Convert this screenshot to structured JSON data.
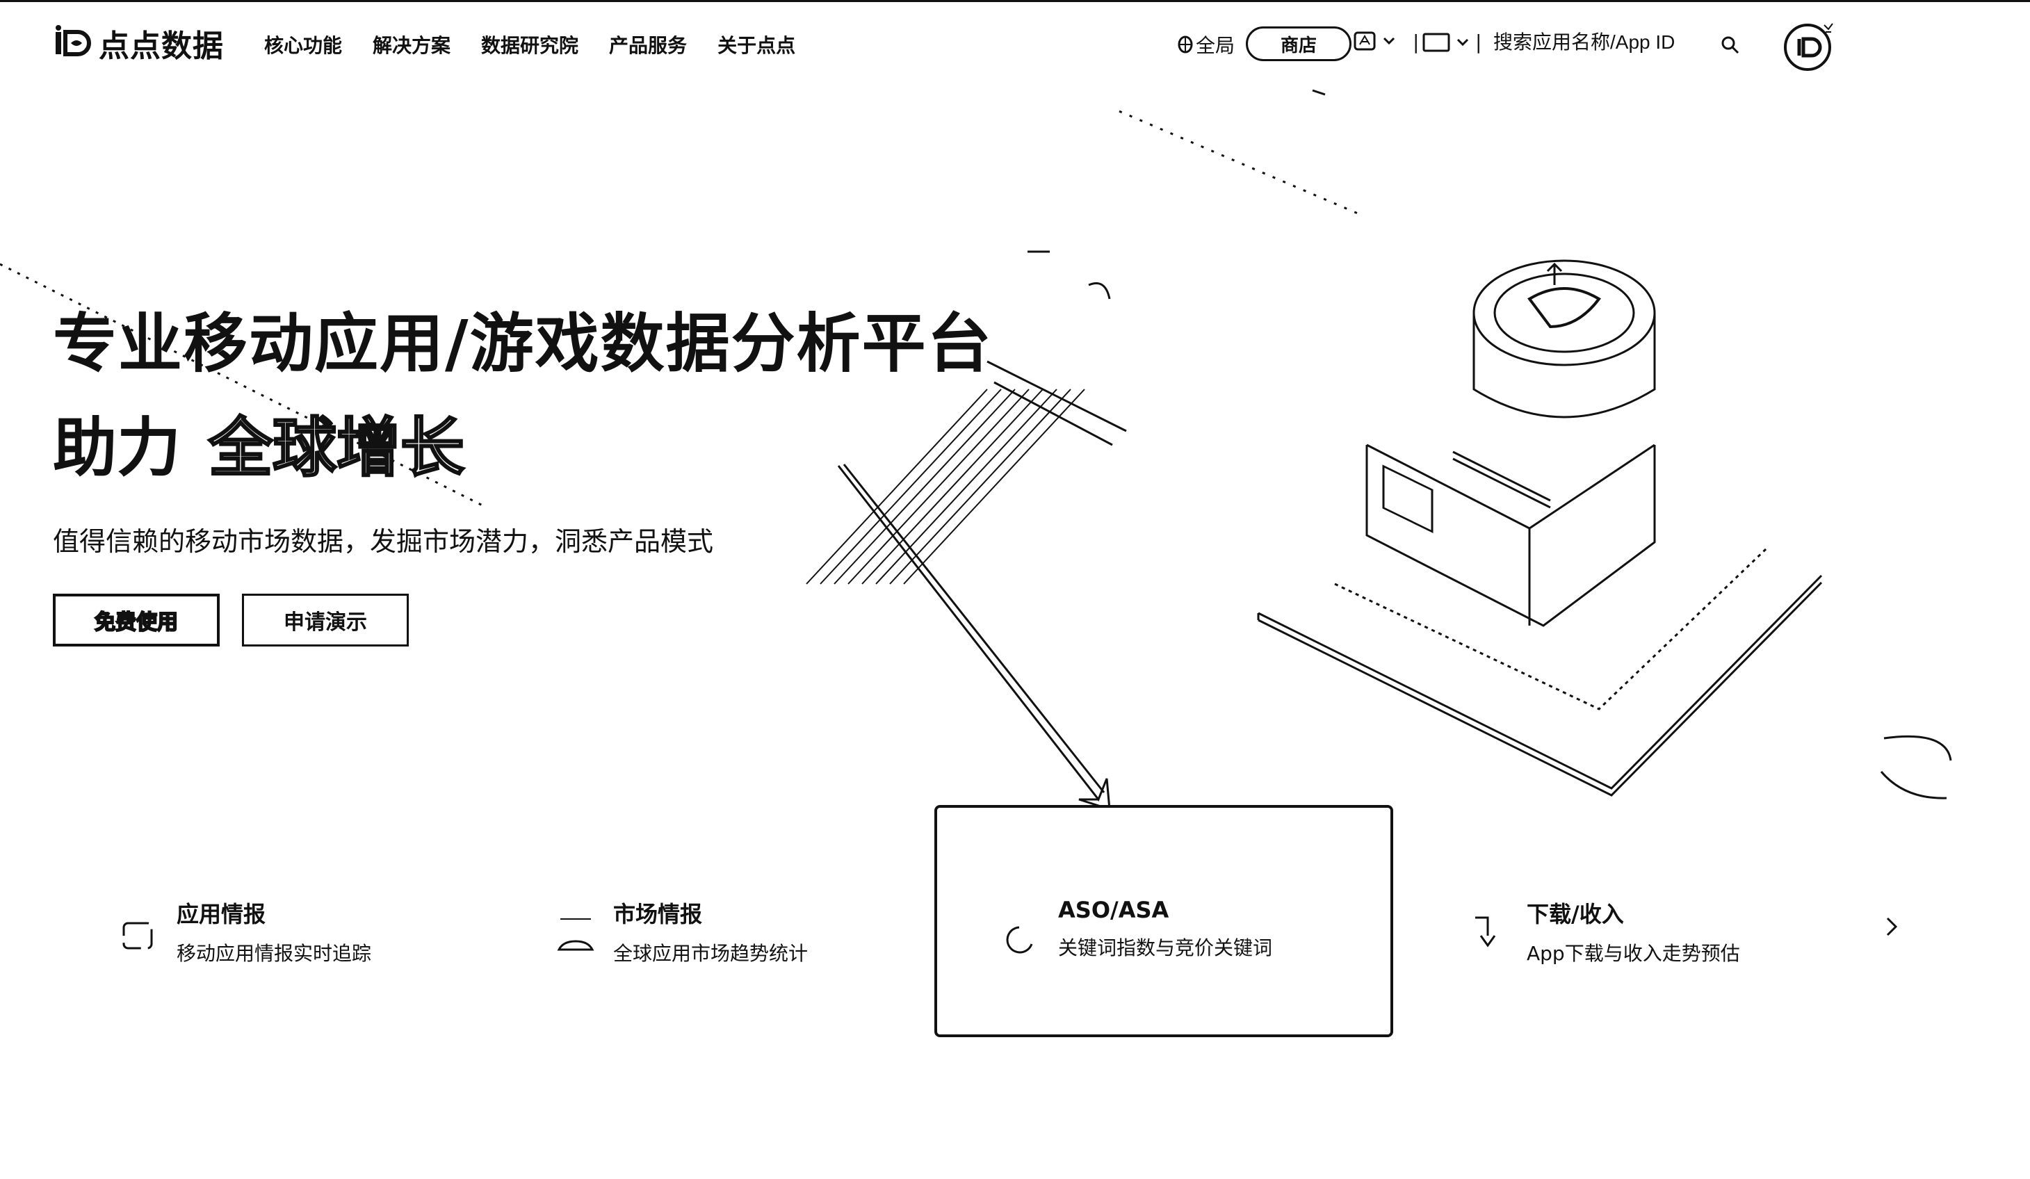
{
  "header": {
    "logo_text": "点点数据",
    "nav": [
      "核心功能",
      "解决方案",
      "数据研究院",
      "产品服务",
      "关于点点"
    ],
    "region_label": "全局",
    "store_label": "商店",
    "separator": "|",
    "search_placeholder": "搜索应用名称/App ID"
  },
  "hero": {
    "title": "专业移动应用/游戏数据分析平台",
    "sub_plain": "助力",
    "sub_outline": "全球增长",
    "description": "值得信赖的移动市场数据，发掘市场潜力，洞悉产品模式",
    "btn_free": "免费使用",
    "btn_demo": "申请演示"
  },
  "features": [
    {
      "title": "应用情报",
      "desc": "移动应用情报实时追踪",
      "icon": "app-icon"
    },
    {
      "title": "市场情报",
      "desc": "全球应用市场趋势统计",
      "icon": "market-icon"
    },
    {
      "title": "ASO/ASA",
      "desc": "关键词指数与竞价关键词",
      "icon": "keyword-icon"
    },
    {
      "title": "下载/收入",
      "desc": "App下载与收入走势预估",
      "icon": "download-icon"
    }
  ]
}
